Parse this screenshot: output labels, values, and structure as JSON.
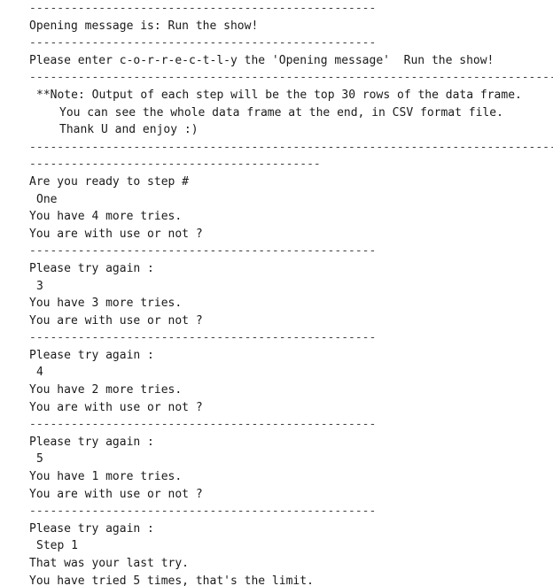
{
  "window": {
    "title": ""
  },
  "lines": [
    {
      "type": "sep",
      "width": "long",
      "text": "--------------------------------------------------"
    },
    {
      "type": "text",
      "indent": 0,
      "text": "Opening message is: Run the show!"
    },
    {
      "type": "sep",
      "width": "long",
      "text": "--------------------------------------------------"
    },
    {
      "type": "text",
      "indent": 0,
      "text": "Please enter c-o-r-r-e-c-t-l-y the 'Opening message'  Run the show!"
    },
    {
      "type": "sep",
      "width": "full",
      "text": "----------------------------------------------------------------------------"
    },
    {
      "type": "text",
      "indent": 1,
      "text": "**Note: Output of each step will be the top 30 rows of the data frame."
    },
    {
      "type": "text",
      "indent": 2,
      "text": "You can see the whole data frame at the end, in CSV format file."
    },
    {
      "type": "text",
      "indent": 2,
      "text": "Thank U and enjoy :)"
    },
    {
      "type": "sep",
      "width": "full",
      "text": "----------------------------------------------------------------------------"
    },
    {
      "type": "sep",
      "width": "mid",
      "text": "------------------------------------------"
    },
    {
      "type": "text",
      "indent": 0,
      "text": "Are you ready to step #"
    },
    {
      "type": "text",
      "indent": 1,
      "text": "One"
    },
    {
      "type": "text",
      "indent": 0,
      "text": "You have 4 more tries."
    },
    {
      "type": "text",
      "indent": 0,
      "text": "You are with use or not ?"
    },
    {
      "type": "sep",
      "width": "short",
      "text": "--------------------------------------------------"
    },
    {
      "type": "text",
      "indent": 0,
      "text": "Please try again :"
    },
    {
      "type": "text",
      "indent": 1,
      "text": "3"
    },
    {
      "type": "text",
      "indent": 0,
      "text": "You have 3 more tries."
    },
    {
      "type": "text",
      "indent": 0,
      "text": "You are with use or not ?"
    },
    {
      "type": "sep",
      "width": "short",
      "text": "--------------------------------------------------"
    },
    {
      "type": "text",
      "indent": 0,
      "text": "Please try again :"
    },
    {
      "type": "text",
      "indent": 1,
      "text": "4"
    },
    {
      "type": "text",
      "indent": 0,
      "text": "You have 2 more tries."
    },
    {
      "type": "text",
      "indent": 0,
      "text": "You are with use or not ?"
    },
    {
      "type": "sep",
      "width": "short",
      "text": "--------------------------------------------------"
    },
    {
      "type": "text",
      "indent": 0,
      "text": "Please try again :"
    },
    {
      "type": "text",
      "indent": 1,
      "text": "5"
    },
    {
      "type": "text",
      "indent": 0,
      "text": "You have 1 more tries."
    },
    {
      "type": "text",
      "indent": 0,
      "text": "You are with use or not ?"
    },
    {
      "type": "sep",
      "width": "short",
      "text": "--------------------------------------------------"
    },
    {
      "type": "text",
      "indent": 0,
      "text": "Please try again :"
    },
    {
      "type": "text",
      "indent": 1,
      "text": "Step 1"
    },
    {
      "type": "text",
      "indent": 0,
      "text": "That was your last try."
    },
    {
      "type": "text",
      "indent": 0,
      "text": "You have tried 5 times, that's the limit."
    }
  ],
  "colors": {
    "background": "#ffffff",
    "text": "#1a1a1a",
    "separator": "#444444"
  }
}
